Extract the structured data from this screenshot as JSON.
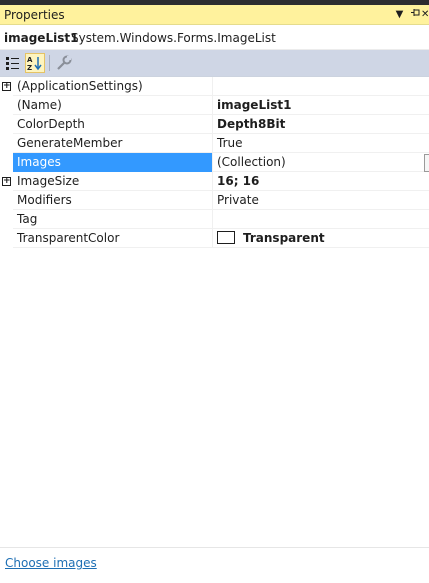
{
  "window": {
    "title": "Properties",
    "dropdown_glyph": "▼",
    "pin_glyph": "⊕",
    "close_glyph": "✕"
  },
  "object": {
    "name": "imageList1",
    "type": "System.Windows.Forms.ImageList"
  },
  "toolbar": {
    "categorized_icon": "categorized-list-icon",
    "alphabetical_icon": "alphabetical-sort-icon",
    "property_pages_icon": "wrench-icon"
  },
  "properties": [
    {
      "name": "(ApplicationSettings)",
      "value": "",
      "expandable": true,
      "expander": "+"
    },
    {
      "name": "(Name)",
      "value": "imageList1",
      "bold": true
    },
    {
      "name": "ColorDepth",
      "value": "Depth8Bit",
      "bold": true
    },
    {
      "name": "GenerateMember",
      "value": "True"
    },
    {
      "name": "Images",
      "value": "(Collection)",
      "selected": true
    },
    {
      "name": "ImageSize",
      "value": "16; 16",
      "bold": true,
      "expandable": true,
      "expander": "+"
    },
    {
      "name": "Modifiers",
      "value": "Private"
    },
    {
      "name": "Tag",
      "value": ""
    },
    {
      "name": "TransparentColor",
      "value": "Transparent",
      "bold": true,
      "swatch": "#ffffff"
    }
  ],
  "command_link": "Choose images",
  "colors": {
    "title_bg": "#fff29d",
    "toolbar_bg": "#cfd6e5",
    "selection": "#3399ff",
    "link": "#1e6fb4"
  }
}
